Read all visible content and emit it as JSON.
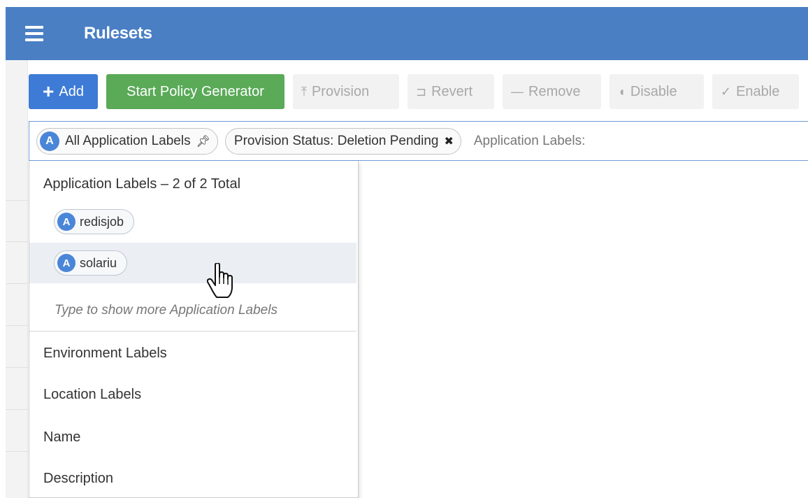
{
  "header": {
    "title": "Rulesets"
  },
  "toolbar": {
    "add": "Add",
    "start_policy_generator": "Start Policy Generator",
    "provision": "Provision",
    "revert": "Revert",
    "remove": "Remove",
    "disable": "Disable",
    "enable": "Enable"
  },
  "filter": {
    "chips": [
      {
        "label": "All Application Labels",
        "icon": "app-label-badge",
        "action": "pin-icon"
      },
      {
        "label": "Provision Status: Deletion Pending",
        "action": "close-icon"
      }
    ],
    "input_prefix": "Application Labels:"
  },
  "dropdown": {
    "header": "Application Labels – 2 of 2 Total",
    "labels": [
      {
        "name": "redisjob",
        "badge": "A"
      },
      {
        "name": "solariu",
        "badge": "A"
      }
    ],
    "hint": "Type to show more Application Labels",
    "categories": [
      "Environment Labels",
      "Location Labels",
      "Name",
      "Description"
    ]
  },
  "colors": {
    "header_bg": "#4a7fc4",
    "primary": "#3d7bd6",
    "success": "#5aaa58",
    "badge": "#4a86d8",
    "hover_row": "#ebeef3"
  }
}
